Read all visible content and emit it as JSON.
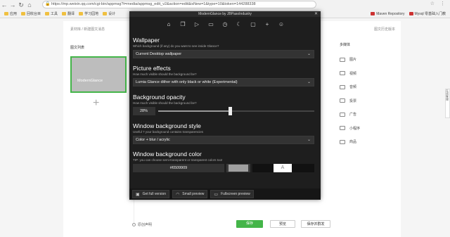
{
  "browser": {
    "url": "https://mp.weixin.qq.com/cgi-bin/appmsg?t=media/appmsg_edit_v2&action=edit&isNew=1&type=10&token=144288338",
    "bookmarks": [
      "应用",
      "回收台目",
      "工具",
      "翻译",
      "学习园地",
      "设计"
    ],
    "bookmarks_right": [
      "Maven Repository",
      "Mysql 零基础入门教"
    ]
  },
  "page": {
    "breadcrumb": "素材库 / 新建图文消息",
    "history_link": "图文历史版本",
    "list_title": "图文列表",
    "thumb_label": "ModernGlance",
    "side_title": "多媒体",
    "side_items": [
      "图片",
      "视频",
      "音频",
      "投票",
      "广告",
      "小程序",
      "商品"
    ],
    "float_tab": "在线客服",
    "footer": {
      "original_label": "原创声明",
      "save_label": "保存",
      "preview_label": "预览",
      "send_label": "保存并群发"
    }
  },
  "dialog": {
    "title": "ModernGlance by JBPasoIndustry",
    "tab_icons": [
      "home-icon",
      "copy-icon",
      "play-icon",
      "window-icon",
      "clock-icon",
      "moon-icon",
      "folder-icon",
      "plus-icon",
      "smile-icon"
    ],
    "wallpaper": {
      "heading": "Wallpaper",
      "sub": "Which background (if any) do you want to see inside Glance?",
      "value": "Current Desktop wallpaper"
    },
    "effects": {
      "heading": "Picture effects",
      "sub": "How much visible should the background be?",
      "value": "Lumia Glance dither with only black or white (Experimental)"
    },
    "opacity": {
      "heading": "Background opacity",
      "sub": "How much visible should the background be?",
      "value_label": "28%",
      "value": 0.46
    },
    "window_style": {
      "heading": "Window background style",
      "sub": "Useful ? your background contains transparencies",
      "value": "Color + blur / acrylic"
    },
    "window_color": {
      "heading": "Window background color",
      "sub": "TIP: you can choose semi-transparent or transparent colors too!",
      "hex": "#6509909",
      "swatch_glyph": "A"
    },
    "footer": {
      "full_label": "Get full version",
      "small_label": "Small preview",
      "fullscreen_label": "Fullscreen preview"
    }
  }
}
